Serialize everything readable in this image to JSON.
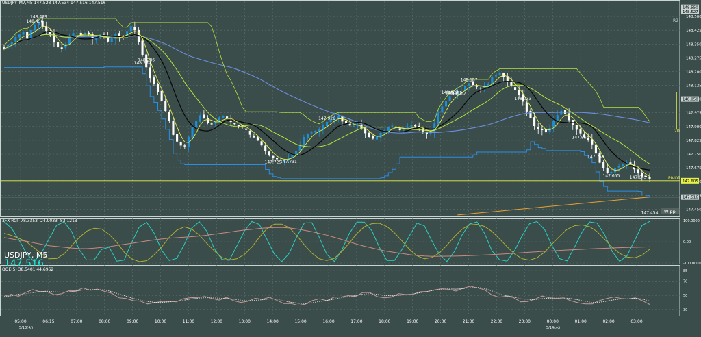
{
  "header": {
    "main": "USDJPY_M7,M5  147.528 147.534 147.516 147.516",
    "osc": "3FX-RCI -78.3353 -24.9033 -83.1213",
    "qqe": "QQE(5) 38.5401 44.6962"
  },
  "symbol_label": "USDJPY, M5",
  "big_price": "147.516",
  "colors": {
    "bg": "#3b4d4a",
    "grid": "#5f7370",
    "bull": "#1c8fd8",
    "bear": "#ffffff",
    "ma_black": "#0a0a0a",
    "ma_yellow": "#e8f04a",
    "ma_lime": "#b8e23c",
    "ma_blue": "#6b8ee0",
    "step_blue": "#2a8ee6",
    "orange": "#e8a030",
    "cyan": "#2ad1c4",
    "olive": "#b0b030",
    "salmon": "#c88a80",
    "qqe_line": "#c89a9a",
    "qqe_dot": "#d8d8d8"
  },
  "chart_data": [
    {
      "type": "candlestick",
      "panel": "main",
      "symbol": "USDJPY_M7",
      "timeframe": "M5",
      "ylim": [
        147.414,
        148.575
      ],
      "y_ticks": [
        "148.500",
        "148.425",
        "148.350",
        "148.275",
        "148.200",
        "148.125",
        "148.050",
        "147.975",
        "147.900",
        "147.825",
        "147.750",
        "147.675",
        "147.600",
        "147.525",
        "147.450"
      ],
      "x_ticks": [
        "05:00",
        "06:15",
        "07:00",
        "08:00",
        "09:00",
        "10:00",
        "11:00",
        "12:00",
        "13:00",
        "14:00",
        "15:00",
        "16:00",
        "17:00",
        "18:00",
        "19:00",
        "20:00",
        "21:30",
        "22:00",
        "23:00",
        "00:00",
        "01:00",
        "02:00",
        "03:00"
      ],
      "date_labels": [
        "5/13(火)",
        "5/14(水)"
      ],
      "close": [
        148.322,
        148.345,
        148.361,
        148.388,
        148.402,
        148.415,
        148.38,
        148.426,
        148.452,
        148.469,
        148.443,
        148.422,
        148.398,
        148.358,
        148.332,
        148.325,
        148.35,
        148.385,
        148.41,
        148.408,
        148.397,
        148.41,
        148.404,
        148.378,
        148.387,
        148.401,
        148.391,
        148.363,
        148.38,
        148.404,
        148.391,
        148.385,
        148.421,
        148.447,
        148.425,
        148.362,
        148.288,
        148.223,
        148.164,
        148.132,
        148.088,
        148.041,
        147.985,
        147.93,
        147.855,
        147.818,
        147.797,
        147.792,
        147.845,
        147.896,
        147.931,
        147.961,
        147.947,
        147.918,
        147.912,
        147.924,
        147.95,
        147.957,
        147.943,
        147.925,
        147.913,
        147.902,
        147.895,
        147.882,
        147.856,
        147.841,
        147.823,
        147.798,
        147.766,
        147.742,
        147.728,
        147.722,
        147.716,
        147.721,
        147.731,
        147.749,
        147.767,
        147.797,
        147.843,
        147.861,
        147.869,
        147.877,
        147.885,
        147.907,
        147.926,
        147.937,
        147.949,
        147.957,
        147.928,
        147.917,
        147.906,
        147.903,
        147.907,
        147.889,
        147.864,
        147.843,
        147.834,
        147.846,
        147.866,
        147.881,
        147.896,
        147.905,
        147.894,
        147.881,
        147.883,
        147.896,
        147.906,
        147.901,
        147.89,
        147.874,
        147.861,
        147.873,
        147.917,
        147.976,
        148.01,
        148.039,
        148.066,
        148.075,
        148.091,
        148.101,
        148.121,
        148.137,
        148.127,
        148.117,
        148.108,
        148.116,
        148.135,
        148.168,
        148.183,
        148.195,
        148.171,
        148.143,
        148.121,
        148.098,
        148.073,
        148.036,
        147.982,
        147.947,
        147.903,
        147.885,
        147.881,
        147.869,
        147.892,
        147.932,
        147.962,
        147.986,
        147.967,
        147.935,
        147.908,
        147.883,
        147.863,
        147.842,
        147.828,
        147.803,
        147.753,
        147.703,
        147.674,
        147.648,
        147.653,
        147.672,
        147.683,
        147.694,
        147.704,
        147.695,
        147.667,
        147.646,
        147.628,
        147.623,
        147.616
      ],
      "highs_labeled": [
        {
          "label": "148.479",
          "price": 148.479
        },
        {
          "label": "148.456",
          "price": 148.456
        },
        {
          "label": "148.033",
          "price": 148.033
        },
        {
          "label": "147.926",
          "price": 147.926
        },
        {
          "label": "148.067",
          "price": 148.067
        },
        {
          "label": "148.065",
          "price": 148.065
        },
        {
          "label": "148.137",
          "price": 148.137
        },
        {
          "label": "148.062",
          "price": 148.062
        }
      ],
      "lows_labeled": [
        {
          "label": "148.269",
          "price": 148.269
        },
        {
          "label": "148.286",
          "price": 148.286
        },
        {
          "label": "147.758",
          "price": 147.758
        },
        {
          "label": "147.729",
          "price": 147.729
        },
        {
          "label": "147.645",
          "price": 147.645
        },
        {
          "label": "147.731",
          "price": 147.731
        },
        {
          "label": "147.863",
          "price": 147.863
        },
        {
          "label": "147.655",
          "price": 147.655
        },
        {
          "label": "147.454",
          "price": 147.454
        }
      ],
      "hlines": [
        {
          "label": "PIVOT",
          "price": 147.605,
          "tag": "147.605",
          "color": "#e8f04a"
        },
        {
          "label": "",
          "price": 147.516,
          "tag": "147.516",
          "color": "#c8d4d2"
        }
      ],
      "right_tags": [
        "148.550",
        "148.527",
        "148.050",
        "147.605",
        "147.516"
      ],
      "annotations": [
        "R2",
        "W-pp",
        "20"
      ]
    },
    {
      "type": "line",
      "panel": "oscillator",
      "name": "3FX-RCI",
      "ylim": [
        -100,
        100
      ],
      "y_ticks": [
        "100.0000",
        "0.00",
        "-100.0000"
      ],
      "series": [
        {
          "color": "#2ad1c4",
          "values": [
            94.9,
            63.4,
            8.2,
            -56.1,
            -93.6,
            -51.1,
            14.8,
            78.1,
            93.3,
            47.9,
            -36.9,
            -85.6,
            -84.6,
            -35.9,
            -25.4,
            -91.0,
            -86.2,
            -3.0,
            69.3,
            91.3,
            39.9,
            -40.8,
            -88.2,
            -78.2,
            -12.6,
            63.9,
            94.5,
            49.7,
            -32.4,
            -82.6,
            -87.3,
            -20.1,
            50.0,
            95.6,
            81.5,
            12.7,
            -57.9,
            -93.2,
            -53.3,
            23.9,
            88.7,
            89.9,
            20.2,
            -59.5,
            -92.7,
            -38.9,
            39.8,
            93.3,
            92.2,
            51.7,
            -26.8,
            -87.8,
            -88.2,
            -36.4,
            28.3,
            87.7,
            75.0,
            3.3,
            -60.1,
            -92.6,
            -45.1,
            31.8,
            83.6,
            93.7,
            39.6,
            -42.6,
            -84.6,
            -90.9,
            -42.4,
            28.0,
            85.5,
            95.4,
            58.1,
            -19.5,
            -79.4,
            -89.8,
            -25.1,
            45.9,
            93.3,
            88.1,
            33.1,
            -45.2,
            -91.8,
            -65.5,
            7.8,
            77.4,
            95.7
          ]
        },
        {
          "color": "#b0b030",
          "values": [
            40.0,
            30.1,
            16.2,
            -0.5,
            -28.5,
            -58.4,
            -80.1,
            -78.6,
            -56.6,
            -18.4,
            20.3,
            49.9,
            63.5,
            59.9,
            34.7,
            -2.0,
            -48.6,
            -80.4,
            -93.5,
            -89.0,
            -60.9,
            -23.9,
            21.4,
            54.9,
            70.1,
            59.6,
            32.2,
            -7.0,
            -42.9,
            -73.6,
            -85.5,
            -80.0,
            -60.0,
            -25.1,
            21.2,
            61.5,
            82.8,
            83.1,
            66.1,
            29.3,
            -14.6,
            -53.4,
            -80.0,
            -88.4,
            -77.5,
            -45.4,
            -4.9,
            39.6,
            70.8,
            85.6,
            87.1,
            71.6,
            42.2,
            4.4,
            -35.8,
            -66.0,
            -79.9,
            -73.9,
            -51.9,
            -16.2,
            24.7,
            59.5,
            79.4,
            82.3,
            72.2,
            48.6,
            14.1,
            -23.1,
            -57.2,
            -79.8,
            -86.0,
            -75.3,
            -48.9,
            -10.5,
            25.7,
            58.8,
            75.4,
            79.4,
            71.0,
            48.0,
            11.5,
            -25.3,
            -54.8,
            -72.0,
            -75.5,
            -63.6,
            -35.2
          ]
        },
        {
          "color": "#c88a80",
          "values": [
            20.0,
            13.6,
            7.0,
            2.1,
            -5.3,
            -11.7,
            -18.7,
            -21.6,
            -25.7,
            -29.3,
            -32.0,
            -32.1,
            -30.1,
            -26.8,
            -22.8,
            -17.3,
            -12.0,
            -7.0,
            -1.5,
            4.2,
            8.7,
            13.1,
            16.7,
            19.3,
            22.0,
            24.3,
            27.2,
            31.0,
            35.7,
            40.6,
            45.2,
            50.8,
            55.0,
            58.3,
            62.6,
            65.6,
            66.8,
            67.4,
            65.0,
            60.4,
            54.1,
            47.3,
            39.4,
            31.3,
            21.1,
            10.7,
            -0.4,
            -11.3,
            -20.9,
            -29.1,
            -37.4,
            -44.7,
            -49.9,
            -55.3,
            -60.5,
            -64.4,
            -67.0,
            -68.6,
            -68.2,
            -67.6,
            -67.3,
            -66.4,
            -65.1,
            -63.6,
            -62.1,
            -60.7,
            -58.5,
            -56.5,
            -54.1,
            -51.5,
            -49.2,
            -47.1,
            -44.8,
            -42.8,
            -40.8,
            -38.7,
            -37.1,
            -35.5,
            -33.7,
            -31.8,
            -30.6,
            -29.1,
            -27.9,
            -26.8,
            -25.7,
            -24.9,
            -24.0
          ]
        }
      ]
    },
    {
      "type": "line",
      "panel": "qqe",
      "name": "QQE(5)",
      "ylim": [
        22,
        88
      ],
      "y_ticks": [
        "85",
        "70",
        "50",
        "30"
      ],
      "series": [
        {
          "color": "#c89a9a",
          "style": "solid",
          "values": [
            48.9,
            51.5,
            48.7,
            54.1,
            58.0,
            55.0,
            55.1,
            50.9,
            52.2,
            56.4,
            56.3,
            60.4,
            57.0,
            58.8,
            55.6,
            53.0,
            46.6,
            45.5,
            42.4,
            41.7,
            37.7,
            39.7,
            41.2,
            41.3,
            40.7,
            45.2,
            46.7,
            46.9,
            48.5,
            45.4,
            43.3,
            47.1,
            42.4,
            39.9,
            41.5,
            45.8,
            44.4,
            47.2,
            43.1,
            38.2,
            38.3,
            35.8,
            37.4,
            42.7,
            45.0,
            42.4,
            47.4,
            47.7,
            49.7,
            48.5,
            53.9,
            53.9,
            48.2,
            46.5,
            47.4,
            52.3,
            51.1,
            51.4,
            55.1,
            55.4,
            57.7,
            59.3,
            58.5,
            56.0,
            60.1,
            62.9,
            60.5,
            57.7,
            50.4,
            47.4,
            48.7,
            46.9,
            40.7,
            41.2,
            44.5,
            49.0,
            46.6,
            45.5,
            46.4,
            42.4,
            39.5,
            37.7,
            37.7,
            42.6,
            45.4,
            47.7,
            45.6,
            44.7,
            46.5,
            42.3,
            37.0
          ]
        },
        {
          "color": "#d8d8d8",
          "style": "dotted",
          "values": [
            48.0,
            49.5,
            51.5,
            52.3,
            53.8,
            55.3,
            55.8,
            54.9,
            54.5,
            54.8,
            55.9,
            57.6,
            58.4,
            58.0,
            57.6,
            55.2,
            51.9,
            48.9,
            45.6,
            43.2,
            41.2,
            40.0,
            39.9,
            40.6,
            41.6,
            43.0,
            44.8,
            45.9,
            46.7,
            46.5,
            46.0,
            45.5,
            44.6,
            43.1,
            42.4,
            42.9,
            43.7,
            44.9,
            44.7,
            42.2,
            40.1,
            38.7,
            38.1,
            39.5,
            41.3,
            42.7,
            44.6,
            46.5,
            48.3,
            49.8,
            51.5,
            52.6,
            51.4,
            50.0,
            49.4,
            50.1,
            50.7,
            52.0,
            53.7,
            55.4,
            57.2,
            58.7,
            59.1,
            58.8,
            59.5,
            60.9,
            61.2,
            59.7,
            56.2,
            52.3,
            49.5,
            47.9,
            45.3,
            44.1,
            44.1,
            45.2,
            46.0,
            46.3,
            46.4,
            45.4,
            43.6,
            41.4,
            39.7,
            40.2,
            41.6,
            43.6,
            44.8,
            45.3,
            45.8,
            44.6,
            42.0
          ]
        }
      ]
    }
  ]
}
